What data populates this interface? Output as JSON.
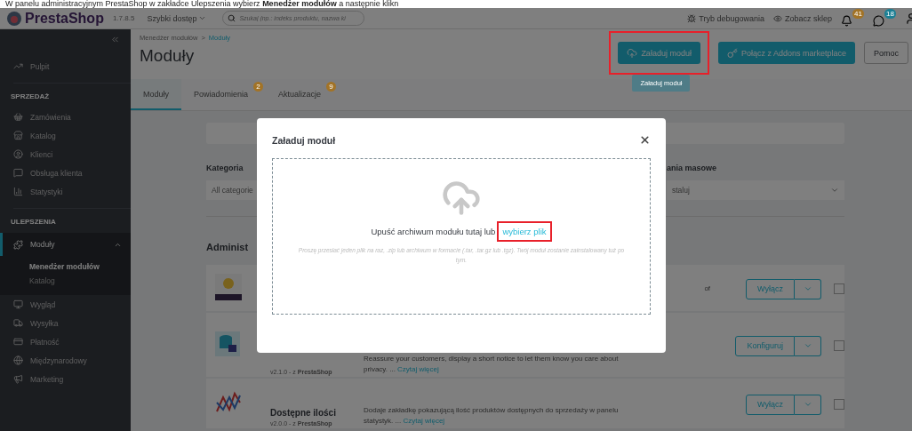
{
  "caption": "W panelu administracyjnym PrestaShop w zakładce Ulepszenia wybierz **Menedżer modułów** a następnie klikn",
  "topbar": {
    "logo": "PrestaShop",
    "version": "1.7.8.5",
    "quick_access": "Szybki dostęp",
    "search": {
      "placeholder": "Szukaj (np.: indeks produktu, nazwa ki"
    },
    "debug": "Tryb debugowania",
    "view_shop": "Zobacz sklep",
    "notifications": [
      {
        "count": "41",
        "color": "#a27326"
      },
      {
        "count": "18",
        "color": "#1b7f94"
      }
    ]
  },
  "sidebar": {
    "top_item": {
      "label": "Pulpit",
      "selected": false
    },
    "sections": [
      {
        "title": "SPRZEDAŻ",
        "items": [
          {
            "label": "Zamówienia",
            "selected": false
          },
          {
            "label": "Katalog",
            "selected": false
          },
          {
            "label": "Klienci",
            "selected": false
          },
          {
            "label": "Obsługa klienta",
            "selected": false
          },
          {
            "label": "Statystyki",
            "selected": false
          }
        ]
      },
      {
        "title": "ULEPSZENIA",
        "items": [
          {
            "label": "Moduły",
            "selected": true,
            "expanded": true,
            "children": [
              {
                "label": "Menedżer modułów",
                "selected": true
              },
              {
                "label": "Katalog",
                "selected": false
              }
            ]
          },
          {
            "label": "Wygląd",
            "selected": false
          },
          {
            "label": "Wysyłka",
            "selected": false
          },
          {
            "label": "Płatność",
            "selected": false
          },
          {
            "label": "Międzynarodowy",
            "selected": false
          },
          {
            "label": "Marketing",
            "selected": false
          }
        ]
      }
    ]
  },
  "page_header": {
    "breadcrumb": [
      "Menedżer modułów",
      "Moduły"
    ],
    "breadcrumb_separator": ">",
    "title": "Moduły",
    "buttons": [
      {
        "kind": "upload",
        "label": "Załaduj moduł",
        "highlighted": true
      },
      {
        "kind": "connect",
        "label": "Połącz z Addons marketplace",
        "highlighted": false
      },
      {
        "kind": "help",
        "label": "Pomoc",
        "highlighted": false
      }
    ],
    "tooltip": "Załaduj moduł"
  },
  "tabs": [
    {
      "label": "Moduły",
      "selected": true
    },
    {
      "label": "Powiadomienia",
      "selected": false,
      "badge": "2"
    },
    {
      "label": "Aktualizacje",
      "selected": false,
      "badge": "9"
    }
  ],
  "filters": {
    "category_label": "Kategoria",
    "category_value": "All categorie",
    "bulk_label": "ania masowe",
    "bulk_value": "staluj"
  },
  "section_title": "Administ",
  "modules": [
    {
      "kind": "bulb",
      "description_tail": "of",
      "action": "Wyłącz",
      "checked": false
    },
    {
      "kind": "database",
      "version": "v2.1.0 - z **PrestaShop**",
      "description": "Reassure your customers, display a short notice to let them know you care about privacy. ...",
      "link": "Czytaj więcej",
      "action": "Konfiguruj",
      "checked": false
    },
    {
      "kind": "chart",
      "name": "Dostępne ilości",
      "version": "v2.0.0 - z **PrestaShop**",
      "description": "Dodaje zakładkę pokazującą ilość produktów dostępnych do sprzedaży w panelu statystyk. ...",
      "link": "Czytaj więcej",
      "action": "Wyłącz",
      "checked": false
    }
  ],
  "modal": {
    "title": "Załaduj moduł",
    "drop_text": "Upuść archiwum modułu tutaj lub",
    "link": {
      "label": "wybierz plik",
      "highlighted": true
    },
    "hint": "Proszę przesłać jeden plik na raz, .zip lub archiwum w formacie (.tar, .tar.gz lub .tgz). Twój moduł zostanie zainstalowany tuż po tym."
  }
}
